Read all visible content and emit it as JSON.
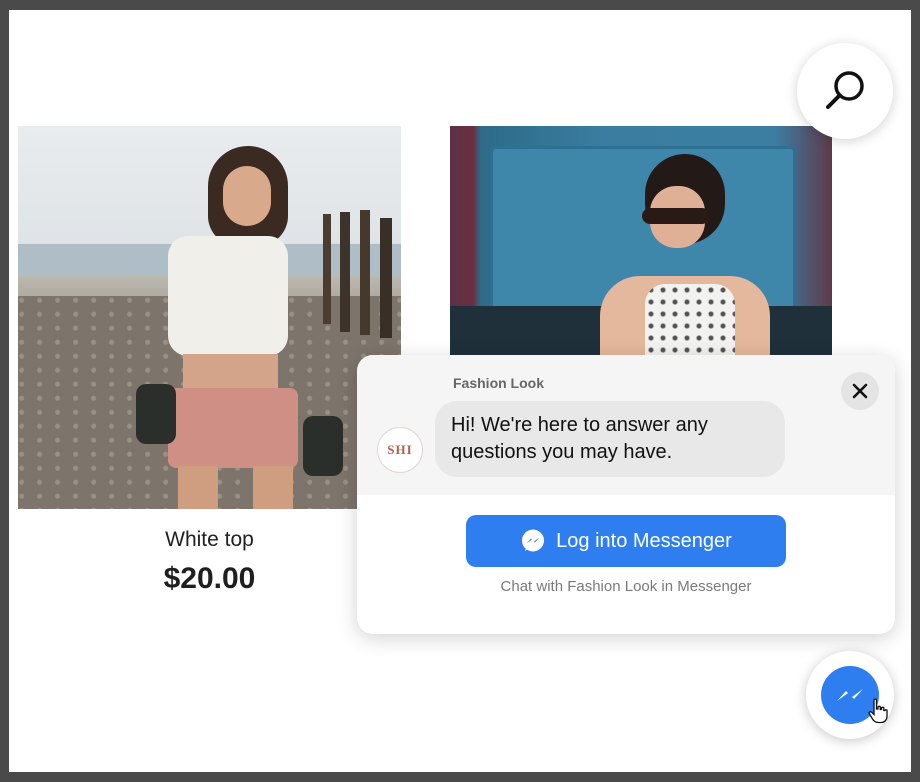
{
  "products": [
    {
      "name": "White top",
      "price": "$20.00",
      "image": "woman-beach-skateboard-photo"
    },
    {
      "image": "woman-sunglasses-truck-photo"
    }
  ],
  "search": {
    "icon": "search-icon"
  },
  "chat_popup": {
    "page_name": "Fashion Look",
    "avatar_text": "SHI",
    "greeting": "Hi! We're here to answer any questions you may have.",
    "login_label": "Log into Messenger",
    "subtext": "Chat with Fashion Look in Messenger",
    "close_icon": "close-icon"
  },
  "messenger_fab": {
    "icon": "messenger-icon"
  },
  "colors": {
    "accent": "#2e7ef0",
    "background": "#ffffff",
    "frame": "#4a4a4a"
  }
}
